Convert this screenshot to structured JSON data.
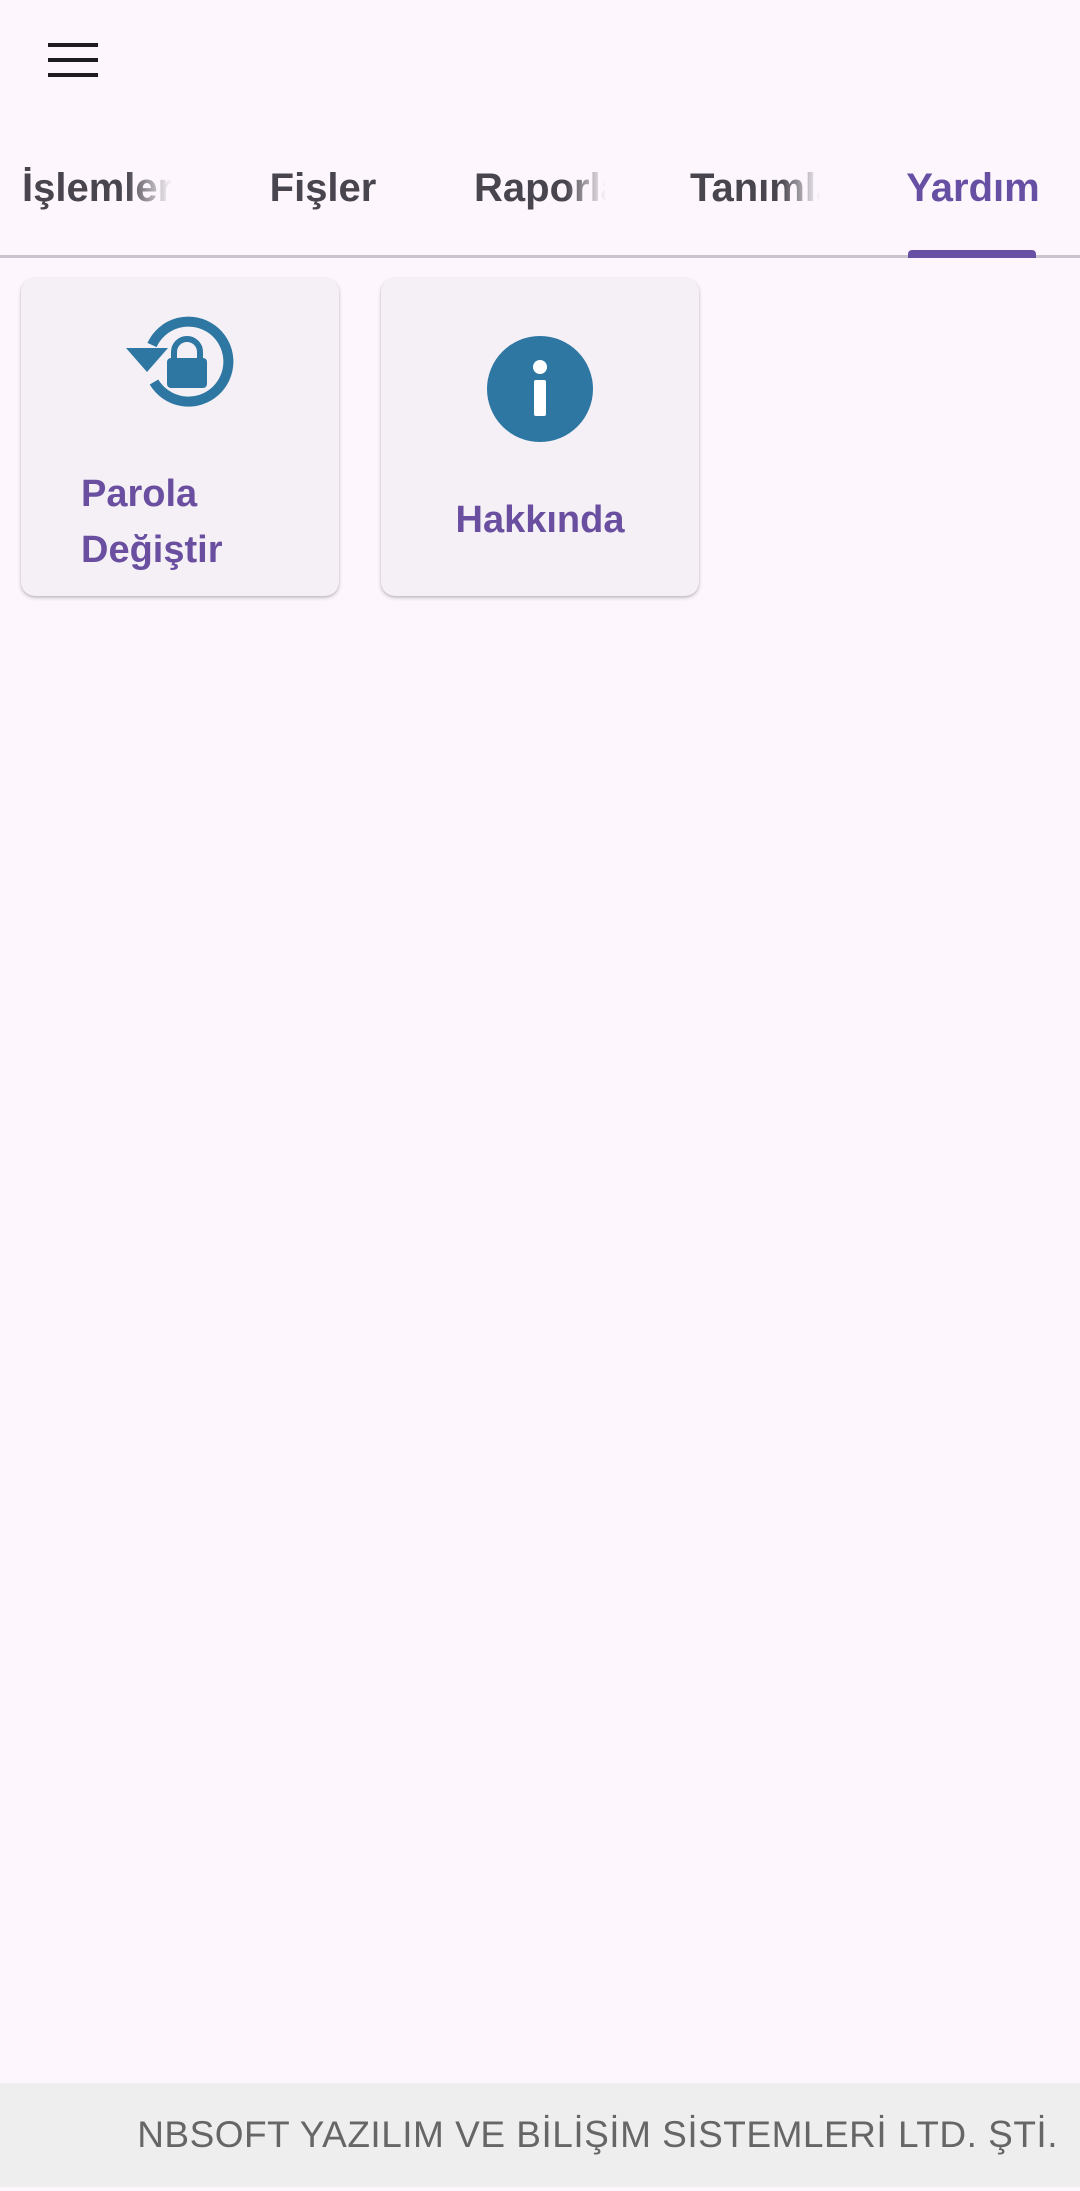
{
  "app_bar": {
    "menu_icon": "hamburger-menu-icon"
  },
  "tabs": [
    {
      "label": "İşlemler",
      "active": false
    },
    {
      "label": "Fişler",
      "active": false
    },
    {
      "label": "Raporlar",
      "active": false
    },
    {
      "label": "Tanımlar",
      "active": false
    },
    {
      "label": "Yardım",
      "active": true
    }
  ],
  "cards": {
    "change_password": {
      "label_line1": "Parola",
      "label_line2": "Değiştir",
      "icon": "lock-reset-icon"
    },
    "about": {
      "label": "Hakkında",
      "icon": "info-icon"
    }
  },
  "footer": {
    "text": "NBSOFT YAZILIM VE BİLİŞİM SİSTEMLERİ LTD. ŞTİ."
  },
  "colors": {
    "accent": "#6750a4",
    "icon": "#2e77a3",
    "background": "#fdf7fd",
    "card": "#f4f0f6"
  }
}
